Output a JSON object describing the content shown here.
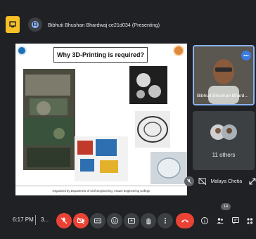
{
  "presenting": {
    "label": "Bibhuti Bhushan Bhardwaj ce21d034 (Presenting)"
  },
  "slide": {
    "title": "Why 3D-Printing is required?",
    "footer": "Organized by Department of Civil Engineering, Assam Engineering College"
  },
  "self_tile": {
    "name": "Bibhuti Bhushan Bhard..."
  },
  "others_tile": {
    "count_label": "11 others"
  },
  "pinned": {
    "name": "Malaya Chetia"
  },
  "bottom_bar": {
    "time": "6:17 PM",
    "meeting_code": "3...",
    "participants_count": "14"
  },
  "icons": {
    "meet_logo": "presentation-screen-icon",
    "presenter": "present-screen-icon",
    "more_options": "more-vert-icon",
    "mic": "mic-off-icon",
    "camera": "videocam-off-icon",
    "captions": "captions-icon",
    "emoji": "emoji-icon",
    "present": "present-to-all-icon",
    "hand": "raise-hand-icon",
    "more": "more-vert-icon",
    "end_call": "call-end-icon",
    "info": "info-icon",
    "people": "people-icon",
    "chat": "chat-icon",
    "activities": "activities-icon"
  },
  "colors": {
    "accent_red": "#ea4335",
    "bar_bg": "#202124",
    "tile_bg": "#3c4043",
    "logo_yellow": "#f6c026",
    "active_border": "#8ab4f8"
  }
}
